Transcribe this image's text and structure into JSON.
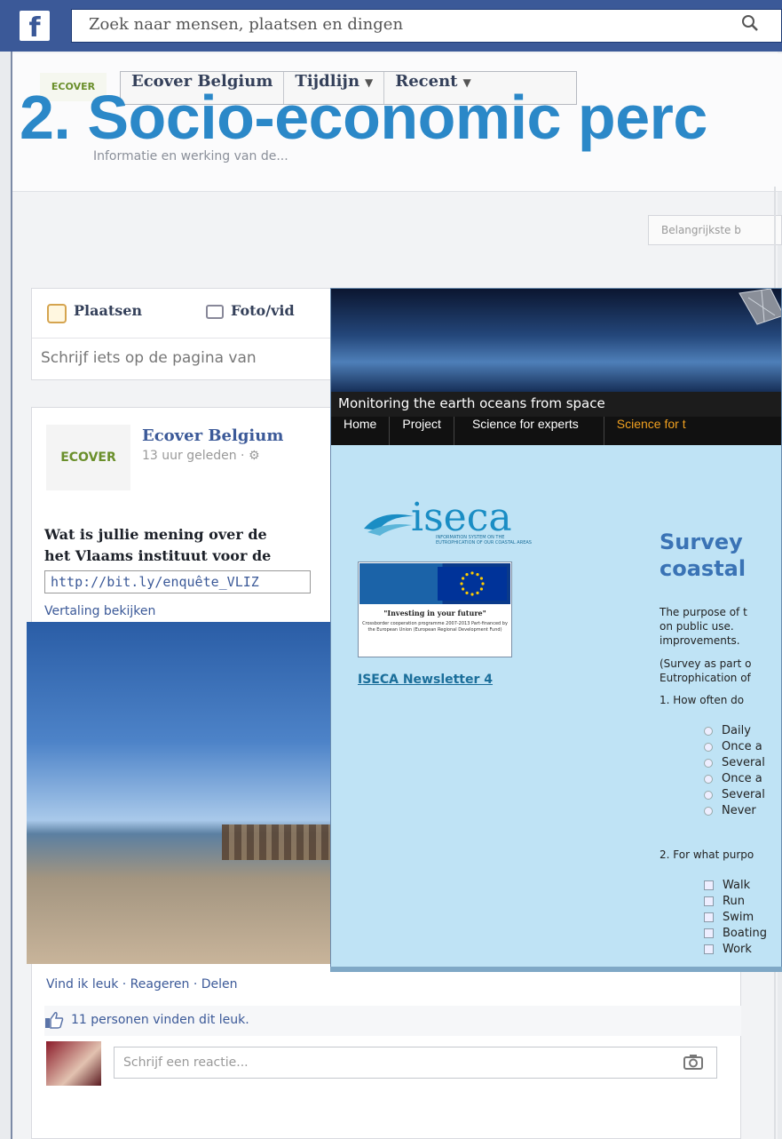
{
  "topbar": {
    "logo": "f",
    "search_placeholder": "Zoek naar mensen, plaatsen en dingen"
  },
  "page": {
    "logo_text": "ECOVER",
    "nav": [
      {
        "label": "Ecover Belgium"
      },
      {
        "label": "Tijdlijn"
      },
      {
        "label": "Recent"
      }
    ],
    "subtitle": "Informatie en werking van de..."
  },
  "slide": {
    "title": "2. Socio-economic perc"
  },
  "sort_button": "Belangrijkste b",
  "composer": {
    "tab_post": "Plaatsen",
    "tab_photo": "Foto/vid",
    "input_placeholder": "Schrijf iets op de pagina van"
  },
  "post": {
    "avatar_text": "ECOVER",
    "author": "Ecover Belgium",
    "time": "13 uur geleden · ⚙",
    "text_line1": "Wat is jullie mening over de",
    "text_line2": "het Vlaams instituut voor de",
    "link": "http://bit.ly/enquête_VLIZ",
    "translate": "Vertaling bekijken",
    "actions": "Vind ik leuk · Reageren · Delen",
    "likes": "11 personen vinden dit leuk.",
    "comment_placeholder": "Schrijf een reactie..."
  },
  "iseca": {
    "banner_text": "Monitoring the earth oceans from space",
    "nav": [
      {
        "label": "Home",
        "active": false
      },
      {
        "label": "Project",
        "active": false
      },
      {
        "label": "Science for experts",
        "active": false
      },
      {
        "label": "Science for t",
        "active": true
      }
    ],
    "logo_word": "iseca",
    "logo_sub": "INFORMATION SYSTEM ON THE EUTROPHICATION OF OUR COASTAL AREAS",
    "card_quote": "\"Investing in your future\"",
    "card_small": "Crossborder cooperation programme 2007-2013 Part-financed by the European Union (European Regional Development Fund)",
    "newsletter": "ISECA Newsletter 4",
    "survey_title_1": "Survey",
    "survey_title_2": "coastal",
    "purpose_1": "The purpose of t",
    "purpose_2": "on  public  use.",
    "purpose_3": "improvements.",
    "note_1": "(Survey as part o",
    "note_2": "Eutrophication of",
    "q1": "1. How often do",
    "q1_options": [
      "Daily",
      "Once a",
      "Several",
      "Once a",
      "Several",
      "Never"
    ],
    "q2": "2. For what purpo",
    "q2_options": [
      "Walk",
      "Run",
      "Swim",
      "Boating",
      "Work"
    ]
  },
  "colors": {
    "facebook_blue": "#3b5998",
    "slide_title": "#2b88c8",
    "iseca_bg": "#bfe3f5",
    "iseca_active_tab": "#f0a020"
  }
}
